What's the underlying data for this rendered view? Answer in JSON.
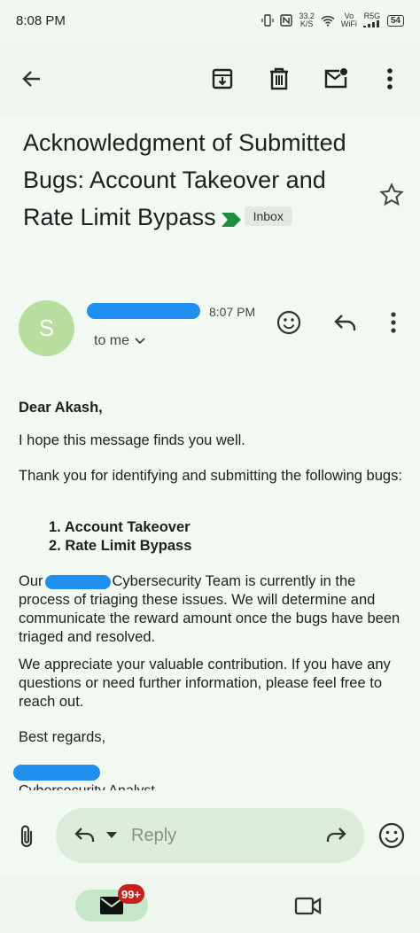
{
  "status_bar": {
    "time": "8:08 PM",
    "net_speed_top": "33.2",
    "net_speed_bottom": "K/S",
    "volte_top": "Vo",
    "volte_bottom": "WiFi",
    "signal_label": "R5G",
    "battery": "54"
  },
  "toolbar": {
    "icons": [
      "back-arrow-icon",
      "archive-icon",
      "delete-icon",
      "mark-unread-icon",
      "more-vert-icon"
    ]
  },
  "email": {
    "subject": "Acknowledgment of Submitted Bugs: Account Takeover and Rate Limit Bypass",
    "label_chip": "Inbox",
    "sender_initial": "S",
    "time": "8:07 PM",
    "recipient": "to me",
    "greeting": "Dear Akash,",
    "paragraph_1": "I hope this message finds you well.",
    "paragraph_2": "Thank you for identifying and submitting the following bugs:",
    "bug_list": [
      "1. Account Takeover",
      "2. Rate Limit Bypass"
    ],
    "paragraph_3_prefix": "Our",
    "paragraph_3_rest": "Cybersecurity Team is currently in the process of triaging these issues. We will determine and communicate the reward amount once the bugs have been triaged and resolved.",
    "paragraph_4": "We appreciate your valuable contribution. If you have any questions or need further information, please feel free to reach out.",
    "closing": "Best regards,",
    "signature_role": "Cybersecurity Analyst"
  },
  "reply_bar": {
    "reply_label": "Reply"
  },
  "bottom_nav": {
    "mail_badge": "99+"
  },
  "colors": {
    "background": "#f2f9f2",
    "avatar": "#b7dd9f",
    "redaction": "#1f8ff0",
    "label_arrow": "#1e8e3e",
    "badge": "#c5221f",
    "reply_pill": "#dcebdc"
  }
}
